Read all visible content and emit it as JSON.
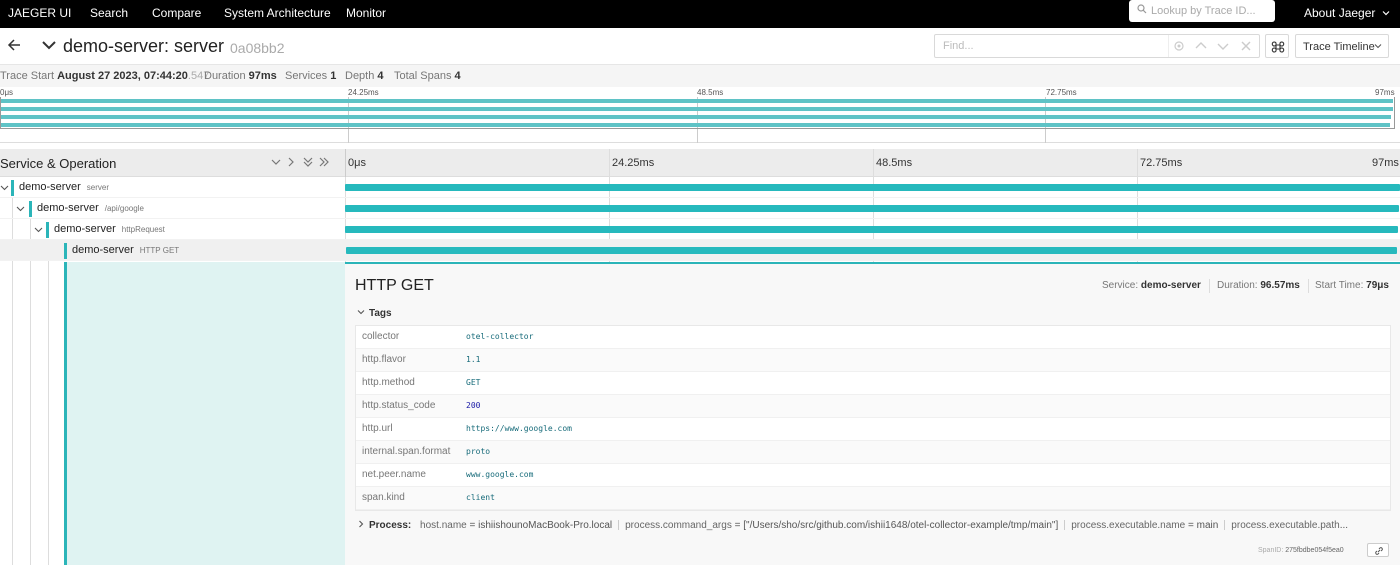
{
  "nav": {
    "brand": "JAEGER UI",
    "items": [
      "Search",
      "Compare",
      "System Architecture",
      "Monitor"
    ],
    "lookup_placeholder": "Lookup by Trace ID...",
    "about": "About Jaeger"
  },
  "trace": {
    "title": "demo-server: server",
    "id": "0a08bb2",
    "find_placeholder": "Find...",
    "view_mode": "Trace Timeline"
  },
  "meta": {
    "trace_start_label": "Trace Start",
    "trace_start_value": "August 27 2023, 07:44:20",
    "trace_start_ms": ".547",
    "duration_label": "Duration",
    "duration_value": "97ms",
    "services_label": "Services",
    "services_value": "1",
    "depth_label": "Depth",
    "depth_value": "4",
    "total_spans_label": "Total Spans",
    "total_spans_value": "4"
  },
  "ticks": [
    "0μs",
    "24.25ms",
    "48.5ms",
    "72.75ms",
    "97ms"
  ],
  "timeline_header": {
    "label": "Service & Operation"
  },
  "spans": [
    {
      "service": "demo-server",
      "operation": "server",
      "depth": 0
    },
    {
      "service": "demo-server",
      "operation": "/api/google",
      "depth": 1
    },
    {
      "service": "demo-server",
      "operation": "httpRequest",
      "depth": 2
    },
    {
      "service": "demo-server",
      "operation": "HTTP GET",
      "depth": 3
    }
  ],
  "detail": {
    "title": "HTTP GET",
    "service_label": "Service:",
    "service_value": "demo-server",
    "duration_label": "Duration:",
    "duration_value": "96.57ms",
    "start_label": "Start Time:",
    "start_value": "79μs",
    "tags_label": "Tags",
    "tags": [
      {
        "key": "collector",
        "value": "otel-collector"
      },
      {
        "key": "http.flavor",
        "value": "1.1"
      },
      {
        "key": "http.method",
        "value": "GET"
      },
      {
        "key": "http.status_code",
        "value": "200"
      },
      {
        "key": "http.url",
        "value": "https://www.google.com"
      },
      {
        "key": "internal.span.format",
        "value": "proto"
      },
      {
        "key": "net.peer.name",
        "value": "www.google.com"
      },
      {
        "key": "span.kind",
        "value": "client"
      }
    ],
    "process_label": "Process:",
    "process": [
      {
        "key": "host.name",
        "value": "ishiishounoMacBook-Pro.local"
      },
      {
        "key": "process.command_args",
        "value": "[\"/Users/sho/src/github.com/ishii1648/otel-collector-example/tmp/main\"]"
      },
      {
        "key": "process.executable.name",
        "value": "main"
      },
      {
        "key": "process.executable.path",
        "value": "..."
      }
    ],
    "span_id_label": "SpanID:",
    "span_id_value": "275fbdbe054f5ea0"
  },
  "colors": {
    "accent": "#2bb5b9",
    "nav_bg": "#000000",
    "detail_bg": "#dff3f2"
  }
}
